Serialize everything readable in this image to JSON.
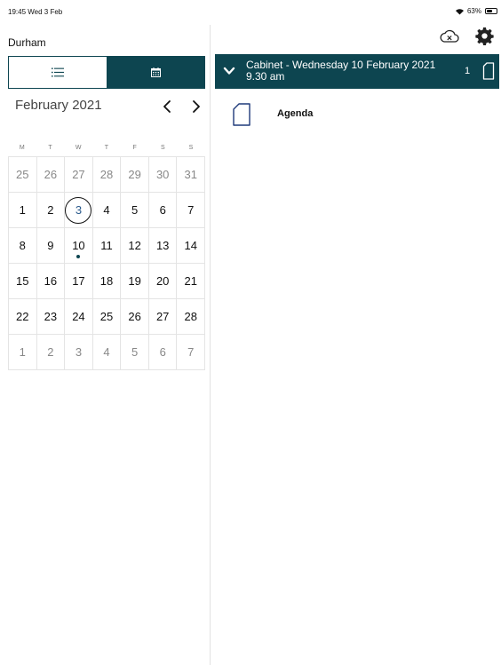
{
  "status_bar": {
    "time_date": "19:45  Wed 3 Feb",
    "battery_text": "63%",
    "battery_level": 0.63
  },
  "sidebar": {
    "council_name": "Durham",
    "view_toggle": {
      "active": "calendar"
    },
    "calendar": {
      "month_title": "February 2021",
      "weekdays": [
        "M",
        "T",
        "W",
        "T",
        "F",
        "S",
        "S"
      ],
      "weeks": [
        [
          {
            "d": "25",
            "muted": true
          },
          {
            "d": "26",
            "muted": true
          },
          {
            "d": "27",
            "muted": true
          },
          {
            "d": "28",
            "muted": true
          },
          {
            "d": "29",
            "muted": true
          },
          {
            "d": "30",
            "muted": true
          },
          {
            "d": "31",
            "muted": true
          }
        ],
        [
          {
            "d": "1"
          },
          {
            "d": "2"
          },
          {
            "d": "3",
            "today": true
          },
          {
            "d": "4"
          },
          {
            "d": "5"
          },
          {
            "d": "6"
          },
          {
            "d": "7"
          }
        ],
        [
          {
            "d": "8"
          },
          {
            "d": "9"
          },
          {
            "d": "10",
            "event": true
          },
          {
            "d": "11"
          },
          {
            "d": "12"
          },
          {
            "d": "13"
          },
          {
            "d": "14"
          }
        ],
        [
          {
            "d": "15"
          },
          {
            "d": "16"
          },
          {
            "d": "17"
          },
          {
            "d": "18"
          },
          {
            "d": "19"
          },
          {
            "d": "20"
          },
          {
            "d": "21"
          }
        ],
        [
          {
            "d": "22"
          },
          {
            "d": "23"
          },
          {
            "d": "24"
          },
          {
            "d": "25"
          },
          {
            "d": "26"
          },
          {
            "d": "27"
          },
          {
            "d": "28"
          }
        ],
        [
          {
            "d": "1",
            "muted": true
          },
          {
            "d": "2",
            "muted": true
          },
          {
            "d": "3",
            "muted": true
          },
          {
            "d": "4",
            "muted": true
          },
          {
            "d": "5",
            "muted": true
          },
          {
            "d": "6",
            "muted": true
          },
          {
            "d": "7",
            "muted": true
          }
        ]
      ]
    }
  },
  "toolbar": {
    "icons": [
      "cloud-sync-icon",
      "gear-icon"
    ]
  },
  "meeting": {
    "title_line1": "Cabinet - Wednesday 10 February 2021",
    "title_line2": "9.30 am",
    "doc_count": "1",
    "documents": [
      {
        "label": "Agenda"
      }
    ]
  },
  "colors": {
    "primary": "#0d4550",
    "today_text": "#2a5a8c",
    "grid_line": "#e4e4e4",
    "muted_text": "#888888"
  }
}
